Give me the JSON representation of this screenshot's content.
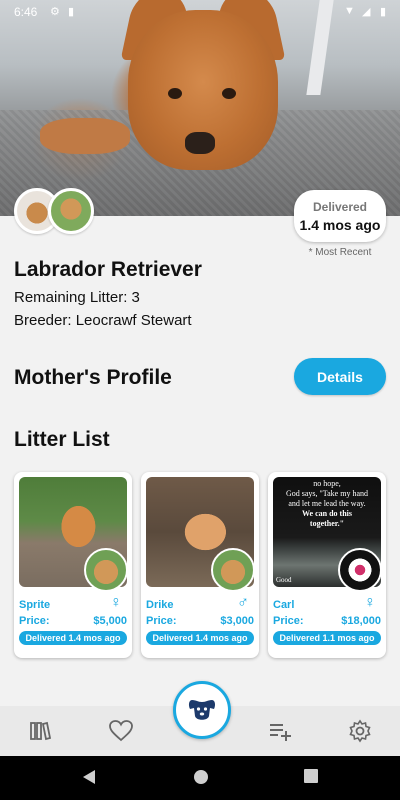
{
  "status_bar": {
    "time": "6:46"
  },
  "header": {
    "delivered_label": "Delivered",
    "delivered_value": "1.4 mos ago",
    "most_recent_note": "* Most Recent"
  },
  "dog": {
    "breed": "Labrador Retriever",
    "remaining_litter": "Remaining Litter: 3",
    "breeder": "Breeder: Leocrawf Stewart"
  },
  "mother_profile": {
    "title": "Mother's Profile",
    "details_label": "Details"
  },
  "litter": {
    "title": "Litter List",
    "items": [
      {
        "name": "Sprite",
        "sex_symbol": "♀",
        "price_label": "Price:",
        "price": "$5,000",
        "status": "Delivered 1.4 mos ago"
      },
      {
        "name": "Drike",
        "sex_symbol": "♂",
        "price_label": "Price:",
        "price": "$3,000",
        "status": "Delivered 1.4 mos ago"
      },
      {
        "name": "Carl",
        "sex_symbol": "♀",
        "price_label": "Price:",
        "price": "$18,000",
        "status": "Delivered 1.1 mos ago"
      }
    ],
    "quote_image_text": [
      "no hope,",
      "God says, \"Take my hand",
      "and let me lead the way.",
      "We can do this",
      "together.\"",
      "Good"
    ]
  },
  "colors": {
    "accent": "#1aa8e0",
    "nav_bg": "#e9e9e9",
    "fab_icon": "#1d3a6b"
  },
  "bottom_nav": {
    "icons": [
      "library-icon",
      "heart-icon",
      "dog-icon",
      "playlist-add-icon",
      "gear-icon"
    ]
  }
}
